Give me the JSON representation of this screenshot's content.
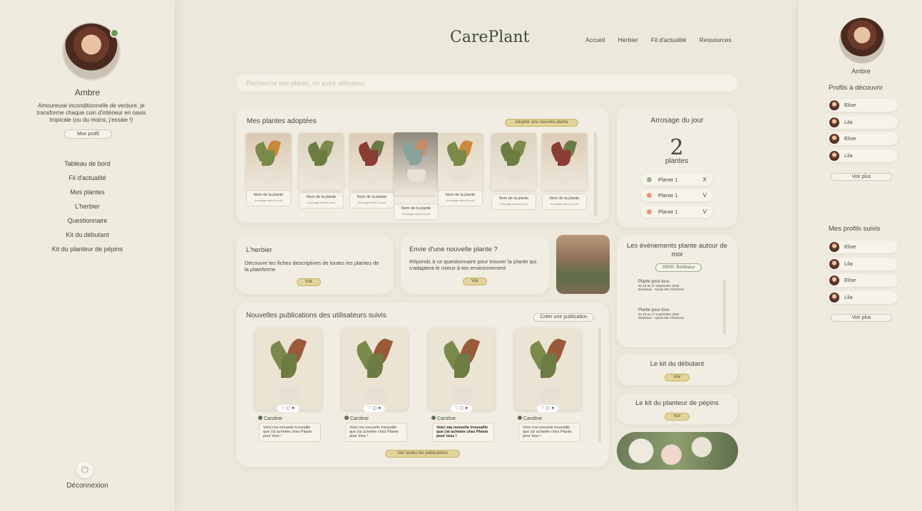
{
  "app": {
    "brand": "CarePlant"
  },
  "top_nav": [
    "Accueil",
    "Herbier",
    "Fil d'actualité",
    "Ressources"
  ],
  "search": {
    "placeholder": "Recherche une plante, un autre utilisateur"
  },
  "profile": {
    "name": "Ambre",
    "bio": "Amoureuse inconditionnelle de verdure, je transforme chaque coin d'intérieur en oasis tropicale (ou du moins, j'essaie !)",
    "button": "Mon profil",
    "status_color": "#6b9c5e"
  },
  "sidebar_nav": [
    "Tableau de bord",
    "Fil d'actualité",
    "Mes plantes",
    "L'herbier",
    "Questionnaire",
    "Kit du débutant",
    "Kit du planteur de pépins"
  ],
  "logout": {
    "label": "Déconnexion",
    "icon": "power-icon"
  },
  "adopted": {
    "title": "Mes plantes adoptées",
    "button": "Adopter une nouvelle plante",
    "plants": [
      {
        "name": "Nom de la plante",
        "water": "Arrosage dans 2 jours"
      },
      {
        "name": "Nom de la plante",
        "water": "Arrosage dans 3 jours"
      },
      {
        "name": "Nom de la plante",
        "water": "Arrosage dans 2 jours"
      },
      {
        "name": "Nom de la plante",
        "water": "Arrosage dans 3 jours"
      },
      {
        "name": "Nom de la plante",
        "water": "Arrosage dans 5 jours"
      },
      {
        "name": "Nom de la plante",
        "water": "Arrosage dans 5 jours"
      },
      {
        "name": "Nom de la plante",
        "water": "Arrosage dans 5 jours"
      }
    ]
  },
  "watering": {
    "title": "Arrosage du jour",
    "count": "2",
    "unit": "plantes",
    "items": [
      {
        "name": "Plante 1",
        "mark": "X",
        "color": "#9bb08a"
      },
      {
        "name": "Plante 1",
        "mark": "V",
        "color": "#e79a72"
      },
      {
        "name": "Plante 1",
        "mark": "V",
        "color": "#e79a72"
      }
    ]
  },
  "herbier": {
    "title": "L'herbier",
    "desc": "Découvre les fiches descriptives de toutes les plantes de la plateforme",
    "button": "Voir"
  },
  "new_plant": {
    "title": "Envie d'une nouvelle plante ?",
    "desc": "Réponds à ce questionnaire pour trouver la plante qui s'adaptera le mieux à ton environnement",
    "button": "Voir"
  },
  "events": {
    "title": "Les évènements plante autour de moi",
    "location": "33000, Bordeaux",
    "items": [
      {
        "title": "Plante pour tous",
        "date": "du 15 au 17 septembre 2024",
        "place": "Bordeaux - Quais des Chartrons"
      },
      {
        "title": "Plante pour tous",
        "date": "du 15 au 17 septembre 2024",
        "place": "Bordeaux - Quais des Chartrons"
      }
    ]
  },
  "posts": {
    "title": "Nouvelles publications des utilisateurs suivis",
    "create_button": "Créer une publication",
    "all_button": "Voir toutes les publications",
    "items": [
      {
        "author": "Caroline",
        "text": "Voici ma nouvelle trouvaille que j'ai achetée chez Plante pour tous !",
        "bold": false
      },
      {
        "author": "Caroline",
        "text": "Voici ma nouvelle trouvaille que j'ai achetée chez Plante pour tous !",
        "bold": false
      },
      {
        "author": "Caroline",
        "text": "Voici ma nouvelle trouvaille que j'ai achetée chez Plante pour tous !",
        "bold": true
      },
      {
        "author": "Caroline",
        "text": "Voici ma nouvelle trouvaille que j'ai achetée chez Plante pour tous !",
        "bold": false
      }
    ]
  },
  "kit_beginner": {
    "title": "Le kit du débutant",
    "button": "Voir"
  },
  "kit_seeds": {
    "title": "Le kit du planteur de pépins",
    "button": "Voir"
  },
  "right_sidebar": {
    "name": "Ambre",
    "discover_title": "Profils à découvrir",
    "discover": [
      "Elise",
      "Lila",
      "Elise",
      "Lila"
    ],
    "following_title": "Mes profils suivis",
    "following": [
      "Elise",
      "Lila",
      "Elise",
      "Lila"
    ],
    "more_button": "Voir plus"
  },
  "colors": {
    "accent": "#e3d49a",
    "background": "#ece8db",
    "card": "#f1ede2",
    "text": "#3f4a3a"
  }
}
